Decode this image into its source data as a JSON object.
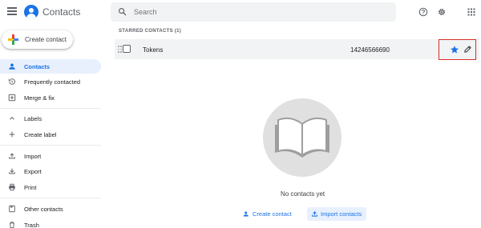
{
  "app": {
    "title": "Contacts"
  },
  "search": {
    "placeholder": "Search"
  },
  "sidebar": {
    "create_label": "Create contact",
    "items": [
      {
        "label": "Contacts",
        "icon": "person-icon",
        "active": true
      },
      {
        "label": "Frequently contacted",
        "icon": "history-icon"
      },
      {
        "label": "Merge & fix",
        "icon": "merge-icon"
      },
      {
        "label": "Labels",
        "icon": "chevron-up-icon"
      },
      {
        "label": "Create label",
        "icon": "plus-icon"
      },
      {
        "label": "Import",
        "icon": "upload-icon"
      },
      {
        "label": "Export",
        "icon": "download-icon"
      },
      {
        "label": "Print",
        "icon": "printer-icon"
      },
      {
        "label": "Other contacts",
        "icon": "other-contacts-icon"
      },
      {
        "label": "Trash",
        "icon": "trash-icon"
      }
    ]
  },
  "main": {
    "starred_header": "STARRED CONTACTS (1)",
    "contacts": [
      {
        "name": "Tokens",
        "phone": "14246566690",
        "starred": true
      }
    ],
    "empty_text": "No contacts yet",
    "create_contact_label": "Create contact",
    "import_contacts_label": "Import contacts"
  },
  "colors": {
    "accent": "#1a73e8",
    "active_bg": "#e8f0fe",
    "highlight_border": "#d93025",
    "row_bg": "#f1f3f4"
  }
}
